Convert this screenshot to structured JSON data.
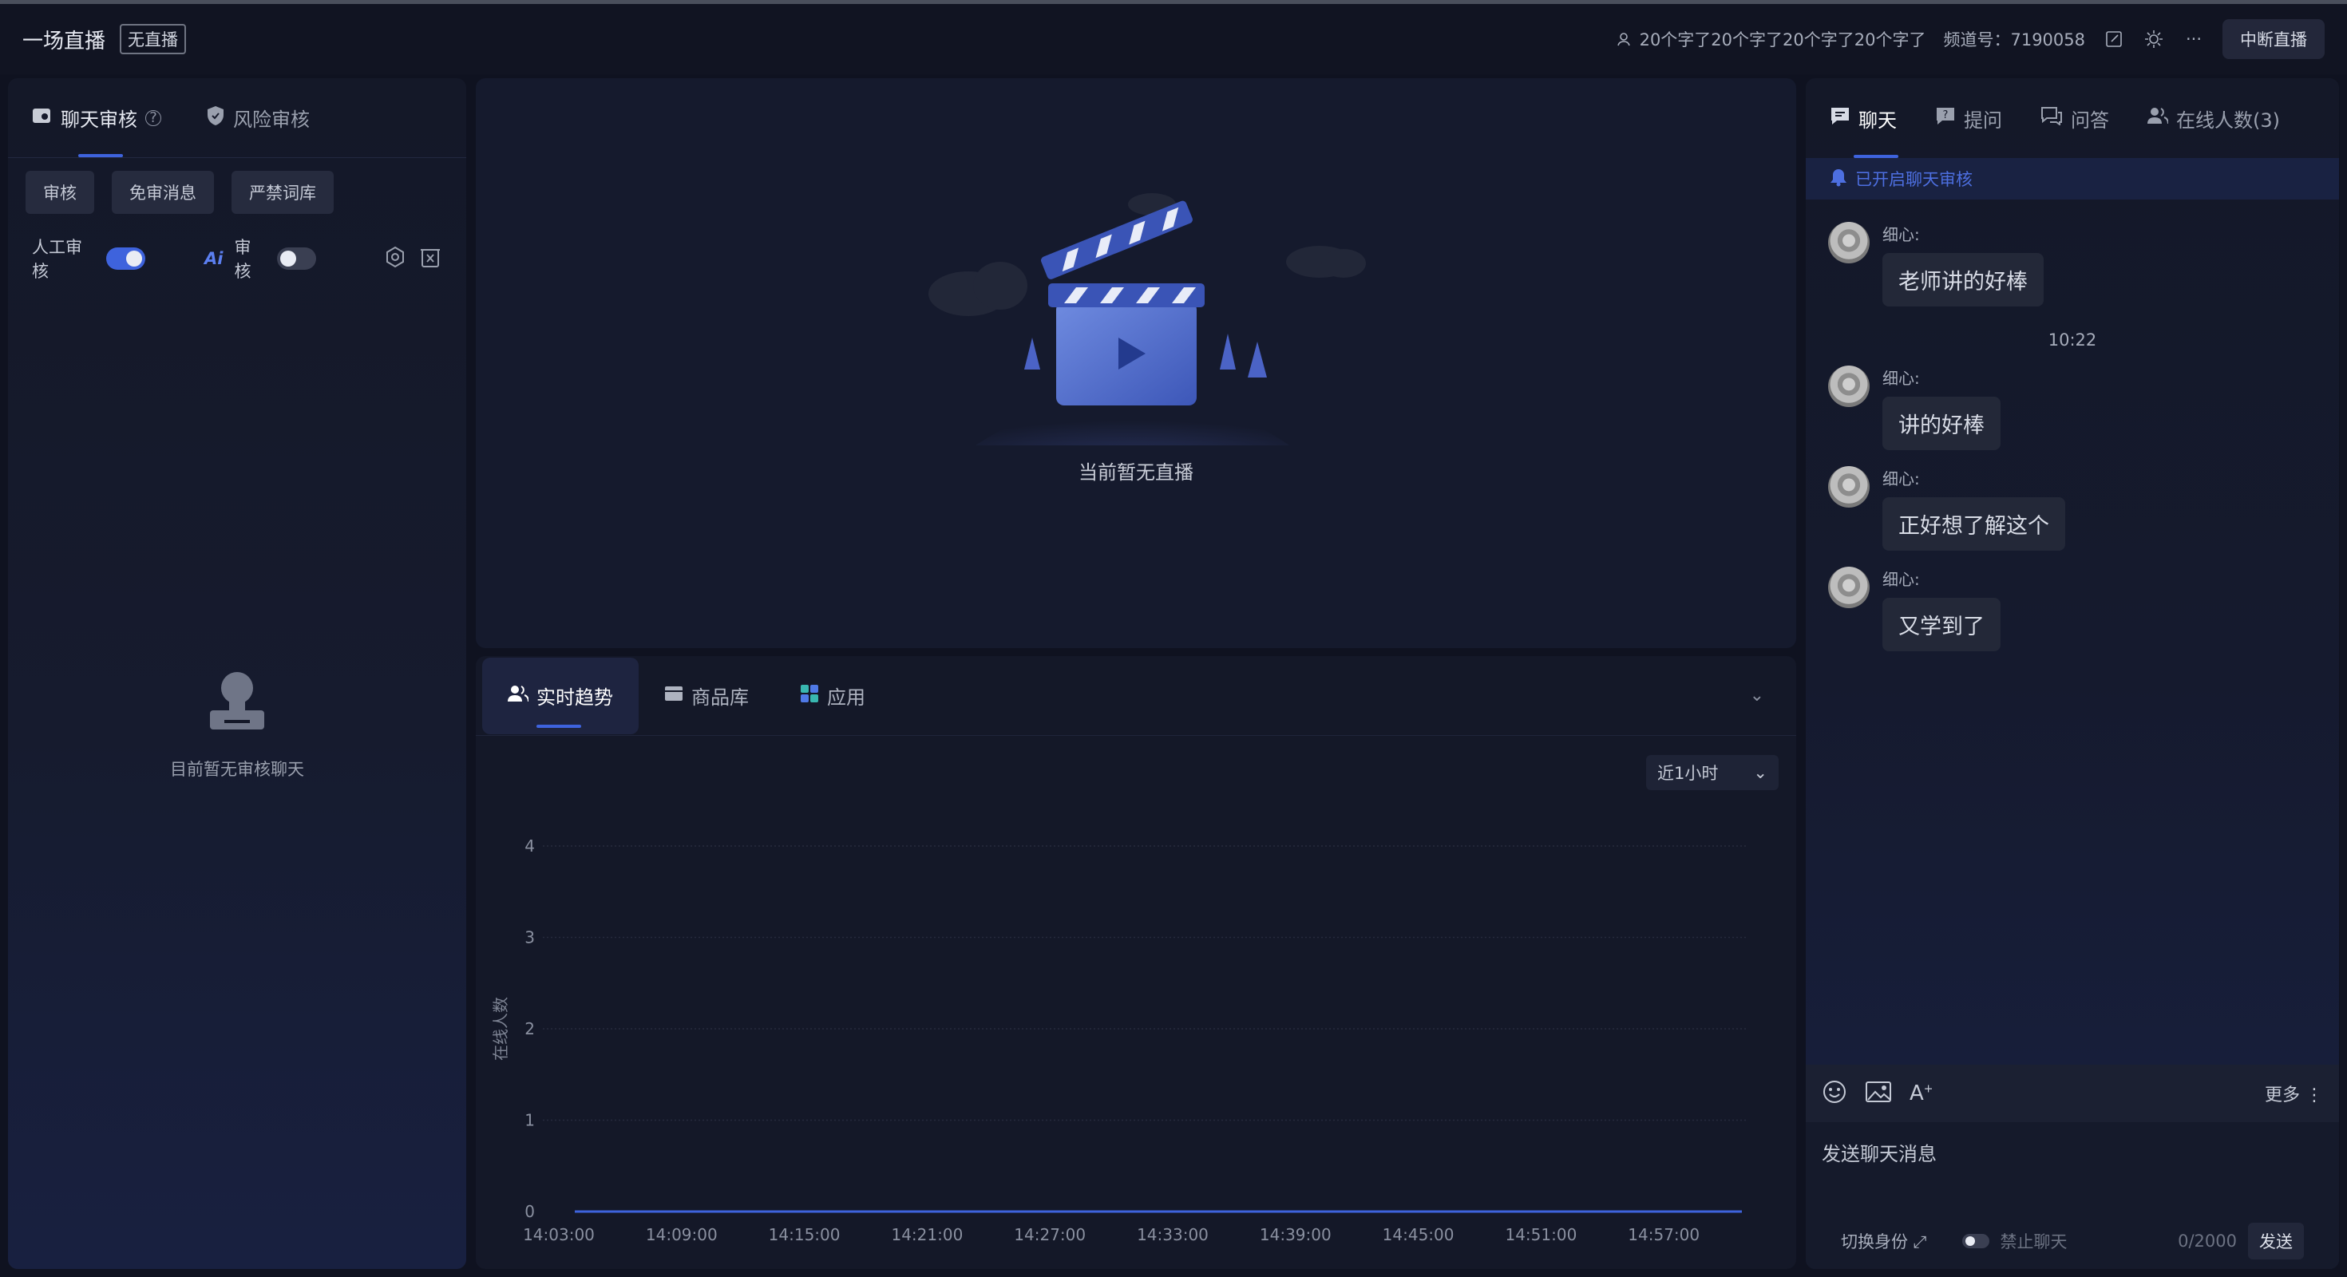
{
  "header": {
    "title": "一场直播",
    "status_badge": "无直播",
    "user_text": "20个字了20个字了20个字了20个字了",
    "channel_label": "频道号：",
    "channel_id": "7190058",
    "stop_button": "中断直播"
  },
  "left": {
    "tabs": [
      {
        "label": "聊天审核",
        "active": true
      },
      {
        "label": "风险审核",
        "active": false
      }
    ],
    "chips": [
      "审核",
      "免审消息",
      "严禁词库"
    ],
    "manual_review_label": "人工审核",
    "manual_review_on": true,
    "ai_label": "Ai",
    "ai_review_label": "审核",
    "ai_review_on": false,
    "empty_text": "目前暂无审核聊天"
  },
  "video": {
    "empty_text": "当前暂无直播"
  },
  "stats": {
    "tabs": [
      {
        "label": "实时趋势",
        "active": true
      },
      {
        "label": "商品库",
        "active": false
      },
      {
        "label": "应用",
        "active": false
      }
    ],
    "range_select": "近1小时"
  },
  "chart_data": {
    "type": "line",
    "ylabel": "在线人数",
    "x": [
      "14:03:00",
      "14:09:00",
      "14:15:00",
      "14:21:00",
      "14:27:00",
      "14:33:00",
      "14:39:00",
      "14:45:00",
      "14:51:00",
      "14:57:00"
    ],
    "ylim": [
      0,
      4
    ],
    "yticks": [
      0,
      1,
      2,
      3,
      4
    ],
    "series": [
      {
        "values": [
          0,
          0,
          0,
          0,
          0,
          0,
          0,
          0,
          0,
          0
        ]
      }
    ],
    "colors": {
      "line": "#3e63dd",
      "grid": "#262b3d"
    }
  },
  "right": {
    "tabs": [
      {
        "label": "聊天",
        "active": true
      },
      {
        "label": "提问",
        "active": false
      },
      {
        "label": "问答",
        "active": false
      },
      {
        "label": "在线人数(3)",
        "active": false
      }
    ],
    "notice": "已开启聊天审核",
    "messages": [
      {
        "name": "细心:",
        "text": "老师讲的好棒"
      },
      {
        "time": "10:22"
      },
      {
        "name": "细心:",
        "text": "讲的好棒"
      },
      {
        "name": "细心:",
        "text": "正好想了解这个"
      },
      {
        "name": "细心:",
        "text": "又学到了"
      }
    ],
    "more_label": "更多",
    "input_placeholder": "发送聊天消息",
    "switch_identity": "切换身份",
    "mute_label": "禁止聊天",
    "char_count": "0/2000",
    "send_button": "发送"
  }
}
